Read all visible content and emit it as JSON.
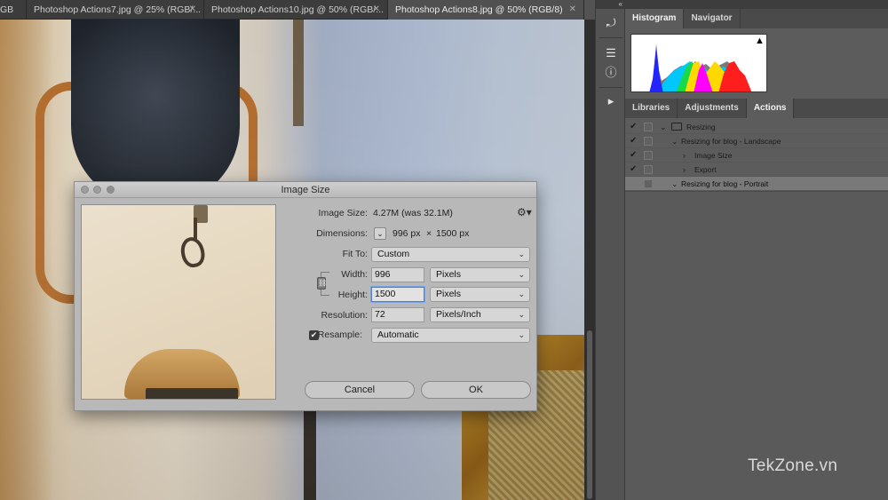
{
  "tabs": [
    {
      "label": "GB",
      "active": false
    },
    {
      "label": "Photoshop Actions7.jpg @ 25% (RGB/...",
      "active": false
    },
    {
      "label": "Photoshop Actions10.jpg @ 50% (RGB/...",
      "active": false
    },
    {
      "label": "Photoshop Actions8.jpg @ 50% (RGB/8)",
      "active": true
    }
  ],
  "panel_tabs_top": [
    "Histogram",
    "Navigator"
  ],
  "panel_tabs_bottom": [
    "Libraries",
    "Adjustments",
    "Actions"
  ],
  "actions": [
    {
      "checked": true,
      "label": "Resizing",
      "level": 0,
      "expanded": true,
      "folder": true
    },
    {
      "checked": true,
      "label": "Resizing for blog - Landscape",
      "level": 1,
      "expanded": true
    },
    {
      "checked": true,
      "label": "Image Size",
      "level": 2,
      "expanded": false
    },
    {
      "checked": true,
      "label": "Export",
      "level": 2,
      "expanded": false
    },
    {
      "checked": false,
      "label": "Resizing for blog - Portrait",
      "level": 1,
      "expanded": true,
      "selected": true
    }
  ],
  "dialog": {
    "title": "Image Size",
    "image_size_label": "Image Size:",
    "image_size_value": "4.27M (was 32.1M)",
    "dimensions_label": "Dimensions:",
    "dimensions_w": "996 px",
    "dimensions_x": "×",
    "dimensions_h": "1500 px",
    "fit_to_label": "Fit To:",
    "fit_to_value": "Custom",
    "width_label": "Width:",
    "width_value": "996",
    "width_unit": "Pixels",
    "height_label": "Height:",
    "height_value": "1500",
    "height_unit": "Pixels",
    "resolution_label": "Resolution:",
    "resolution_value": "72",
    "resolution_unit": "Pixels/Inch",
    "resample_label": "Resample:",
    "resample_checked": true,
    "resample_value": "Automatic",
    "cancel_label": "Cancel",
    "ok_label": "OK"
  },
  "watermark": "TekZone.vn",
  "colors": {
    "accent_focus": "#4c7fd0",
    "panel_bg": "#5c5c5c",
    "dialog_bg": "#b8b8b8"
  }
}
